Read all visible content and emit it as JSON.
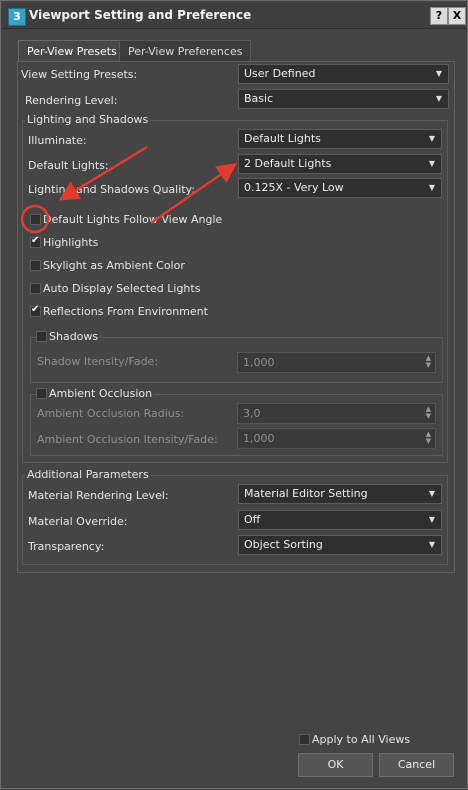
{
  "window": {
    "title": "Viewport Setting and Preference",
    "app_icon": "3",
    "help_btn": "?",
    "close_btn": "X"
  },
  "tabs": [
    {
      "label": "Per-View Presets"
    },
    {
      "label": "Per-View Preferences"
    }
  ],
  "presets": {
    "view_setting_presets": {
      "label": "View Setting Presets:",
      "value": "User Defined"
    },
    "rendering_level": {
      "label": "Rendering Level:",
      "value": "Basic"
    }
  },
  "lighting": {
    "group_title": "Lighting and Shadows",
    "illuminate": {
      "label": "Illuminate:",
      "value": "Default Lights"
    },
    "default_lights": {
      "label": "Default Lights:",
      "value": "2 Default Lights"
    },
    "quality": {
      "label": "Lighting and Shadows Quality:",
      "value": "0.125X - Very Low"
    },
    "checkboxes": [
      {
        "label": "Default Lights Follow View Angle",
        "checked": false
      },
      {
        "label": "Highlights",
        "checked": true
      },
      {
        "label": "Skylight as Ambient Color",
        "checked": false
      },
      {
        "label": "Auto Display Selected Lights",
        "checked": false
      },
      {
        "label": "Reflections From Environment",
        "checked": true
      }
    ],
    "shadows": {
      "label": "Shadows",
      "checked": false,
      "intensity_label": "Shadow Itensity/Fade:",
      "intensity_value": "1,000"
    },
    "ambient_occlusion": {
      "label": "Ambient Occlusion",
      "checked": false,
      "radius_label": "Ambient Occlusion Radius:",
      "radius_value": "3,0",
      "intensity_label": "Ambient Occlusion Itensity/Fade:",
      "intensity_value": "1,000"
    }
  },
  "additional": {
    "group_title": "Additional Parameters",
    "material_rendering_level": {
      "label": "Material Rendering Level:",
      "value": "Material Editor Setting"
    },
    "material_override": {
      "label": "Material Override:",
      "value": "Off"
    },
    "transparency": {
      "label": "Transparency:",
      "value": "Object Sorting"
    }
  },
  "footer": {
    "apply_all": {
      "label": "Apply to All Views",
      "checked": false
    },
    "ok": "OK",
    "cancel": "Cancel"
  },
  "annotations": {
    "color": "#e23a2f"
  }
}
